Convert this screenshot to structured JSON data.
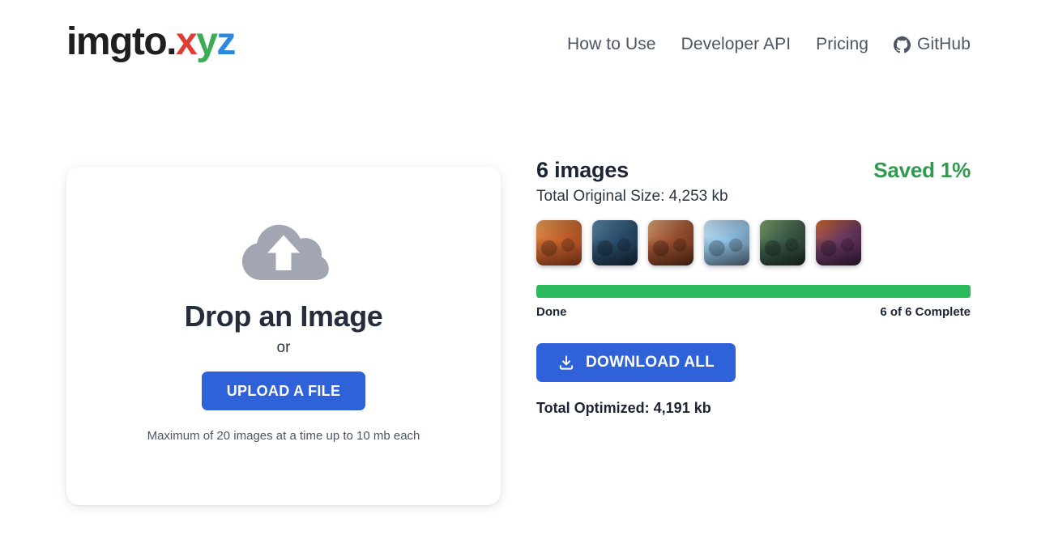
{
  "header": {
    "logo": {
      "base": "imgto.",
      "x": "x",
      "y": "y",
      "z": "z"
    },
    "nav": [
      {
        "label": "How to Use",
        "name": "nav-how-to-use"
      },
      {
        "label": "Developer API",
        "name": "nav-developer-api"
      },
      {
        "label": "Pricing",
        "name": "nav-pricing"
      },
      {
        "label": "GitHub",
        "name": "nav-github",
        "icon": "github-icon"
      }
    ]
  },
  "upload": {
    "icon": "cloud-upload-icon",
    "title": "Drop an Image",
    "or": "or",
    "button_label": "UPLOAD A FILE",
    "note": "Maximum of 20 images at a time up to 10 mb each"
  },
  "results": {
    "count_title": "6 images",
    "saved_label": "Saved 1%",
    "original_size": "Total Original Size: 4,253 kb",
    "thumbnails": [
      {
        "alt": "thumbnail-1",
        "c1": "#c8622c",
        "c2": "#7d3318",
        "c3": "#e8a05a"
      },
      {
        "alt": "thumbnail-2",
        "c1": "#2b4f6e",
        "c2": "#11202f",
        "c3": "#5b8ba8"
      },
      {
        "alt": "thumbnail-3",
        "c1": "#9d5030",
        "c2": "#4a2413",
        "c3": "#d8a777"
      },
      {
        "alt": "thumbnail-4",
        "c1": "#8fc2e6",
        "c2": "#4a5a6b",
        "c3": "#cfe4f3"
      },
      {
        "alt": "thumbnail-5",
        "c1": "#3c5b48",
        "c2": "#16241c",
        "c3": "#7fa36a"
      },
      {
        "alt": "thumbnail-6",
        "c1": "#6d3a63",
        "c2": "#2a1430",
        "c3": "#d4682f"
      }
    ],
    "progress": {
      "percent": 100,
      "status_label": "Done",
      "complete_label": "6 of 6 Complete"
    },
    "download_label": "DOWNLOAD ALL",
    "download_icon": "download-icon",
    "total_optimized": "Total Optimized: 4,191 kb"
  },
  "colors": {
    "accent_blue": "#2f62d8",
    "progress_green": "#2bba5e",
    "saved_green": "#2e9b4f",
    "logo_red": "#e03c31",
    "logo_green": "#3bab57",
    "logo_blue": "#2b8ae0",
    "text_dark": "#1b2435",
    "background": "#ffffff"
  }
}
